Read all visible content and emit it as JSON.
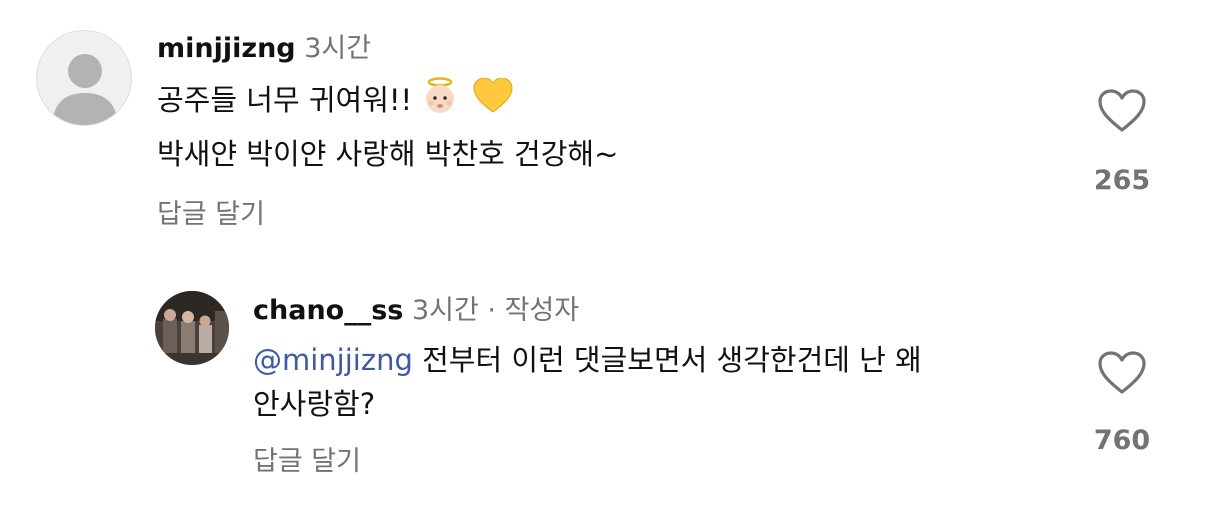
{
  "comments": [
    {
      "username": "minjjizng",
      "time": "3시간",
      "author_tag": "",
      "line1": "공주들 너무 귀여워!!",
      "line1_emojis": [
        "baby-angel-emoji",
        "yellow-heart-emoji"
      ],
      "line2": "박새얀 박이얀 사랑해 박찬호 건강해~",
      "reply_label": "답글 달기",
      "likes": "265"
    },
    {
      "username": "chano__ss",
      "time": "3시간",
      "separator": "·",
      "author_tag": "작성자",
      "mention": "@minjjizng",
      "line1": " 전부터 이런 댓글보면서 생각한건데 난 왜",
      "line2": "안사랑함?",
      "reply_label": "답글 달기",
      "likes": "760"
    }
  ],
  "colors": {
    "meta": "#737373",
    "mention": "#3f5aa6",
    "text": "#111111"
  }
}
